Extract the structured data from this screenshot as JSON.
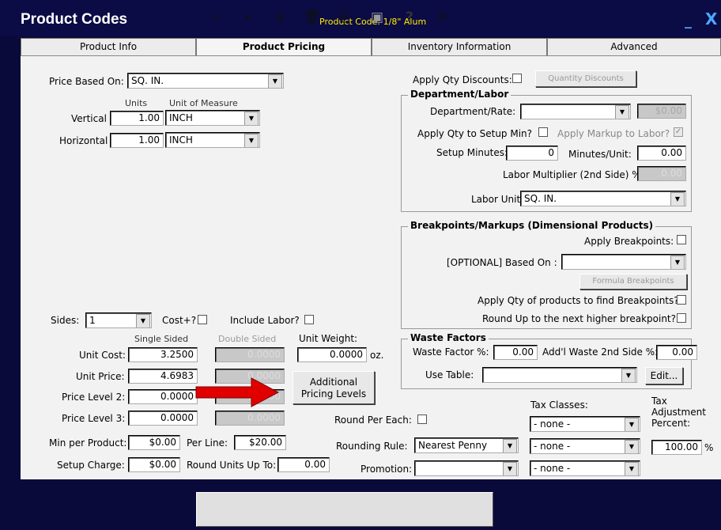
{
  "window": {
    "title": "Product Codes",
    "subtitle": "Product Code: 1/8\" Alum",
    "minimize": "_",
    "close": "X"
  },
  "tabs": [
    "Product Info",
    "Product Pricing",
    "Inventory Information",
    "Advanced"
  ],
  "left": {
    "price_based_on_label": "Price Based On:",
    "price_based_on": "SQ. IN.",
    "units_header": "Units",
    "uom_header": "Unit of Measure",
    "vertical_label": "Vertical",
    "vertical_units": "1.00",
    "vertical_uom": "INCH",
    "horizontal_label": "Horizontal",
    "horizontal_units": "1.00",
    "horizontal_uom": "INCH",
    "sides_label": "Sides:",
    "sides_value": "1",
    "cost_plus_label": "Cost+?",
    "include_labor_label": "Include Labor?",
    "single_sided_header": "Single Sided",
    "double_sided_header": "Double Sided",
    "unit_weight_label": "Unit Weight:",
    "unit_weight": "0.0000",
    "unit_weight_unit": "oz.",
    "unit_cost_label": "Unit Cost:",
    "unit_cost": "3.2500",
    "unit_cost_ds": "0.0000",
    "unit_price_label": "Unit Price:",
    "unit_price": "4.6983",
    "unit_price_ds": "0.0000",
    "price_level2_label": "Price Level 2:",
    "price_level2": "0.0000",
    "price_level2_ds": "0.0000",
    "price_level3_label": "Price Level 3:",
    "price_level3": "0.0000",
    "price_level3_ds": "0.0000",
    "additional_pricing_line1": "Additional",
    "additional_pricing_line2": "Pricing Levels",
    "min_per_product_label": "Min per Product:",
    "min_per_product": "$0.00",
    "per_line_label": "Per Line:",
    "per_line": "$20.00",
    "setup_charge_label": "Setup Charge:",
    "setup_charge": "$0.00",
    "round_units_label": "Round Units Up To:",
    "round_units": "0.00"
  },
  "right": {
    "apply_qty_discounts_label": "Apply Qty Discounts:",
    "quantity_discounts_button": "Quantity Discounts",
    "dept_group_title": "Department/Labor",
    "dept_rate_label": "Department/Rate:",
    "dept_rate_value": "",
    "dept_rate_amount": "$0.00",
    "apply_qty_setup_label": "Apply Qty to Setup Min?",
    "apply_markup_label": "Apply Markup to Labor?",
    "setup_minutes_label": "Setup Minutes:",
    "setup_minutes": "0",
    "minutes_unit_label": "Minutes/Unit:",
    "minutes_unit": "0.00",
    "labor_mult_label": "Labor Multiplier (2nd Side) %:",
    "labor_mult": "0.00",
    "labor_units_label": "Labor Units:",
    "labor_units": "SQ. IN.",
    "break_group_title": "Breakpoints/Markups (Dimensional Products)",
    "apply_breakpoints_label": "Apply Breakpoints:",
    "optional_based_on_label": "[OPTIONAL] Based On :",
    "formula_breakpoints_button": "Formula Breakpoints",
    "apply_qty_products_label": "Apply Qty of products to find Breakpoints?",
    "round_up_label": "Round Up to the next higher breakpoint?",
    "waste_group_title": "Waste Factors",
    "waste_factor_label": "Waste Factor %:",
    "waste_factor": "0.00",
    "addl_waste_label": "Add'l Waste 2nd Side %:",
    "addl_waste": "0.00",
    "use_table_label": "Use Table:",
    "edit_button": "Edit...",
    "round_per_each_label": "Round Per Each:",
    "rounding_rule_label": "Rounding Rule:",
    "rounding_rule": "Nearest Penny",
    "promotion_label": "Promotion:",
    "tax_classes_label": "Tax Classes:",
    "tax_class1": "- none -",
    "tax_class2": "- none -",
    "tax_class3": "- none -",
    "tax_adj_line1": "Tax",
    "tax_adj_line2": "Adjustment",
    "tax_adj_line3": "Percent:",
    "tax_adj": "100.00",
    "tax_adj_unit": "%"
  },
  "toolbar": {
    "first": "«",
    "last": "»",
    "find": "⚲",
    "delete": "🗑",
    "open": "⎘",
    "save": "▣",
    "help": "?",
    "close": "✕"
  },
  "colors": {
    "window_bg": "#0b0b45",
    "title_text": "#ffffff",
    "subtitle_text": "#ffee00",
    "arrow": "#e00000"
  }
}
